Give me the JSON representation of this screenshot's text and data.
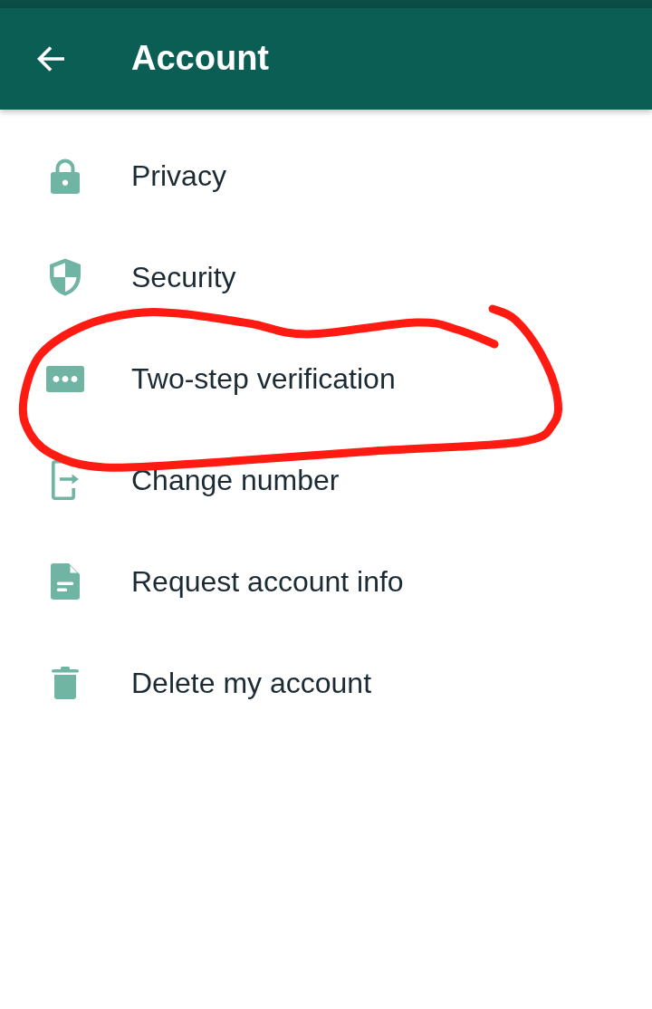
{
  "app_bar": {
    "title": "Account"
  },
  "items": [
    {
      "label": "Privacy",
      "circled": false
    },
    {
      "label": "Security",
      "circled": false
    },
    {
      "label": "Two-step verification",
      "circled": true
    },
    {
      "label": "Change number",
      "circled": false
    },
    {
      "label": "Request account info",
      "circled": false
    },
    {
      "label": "Delete my account",
      "circled": false
    }
  ]
}
